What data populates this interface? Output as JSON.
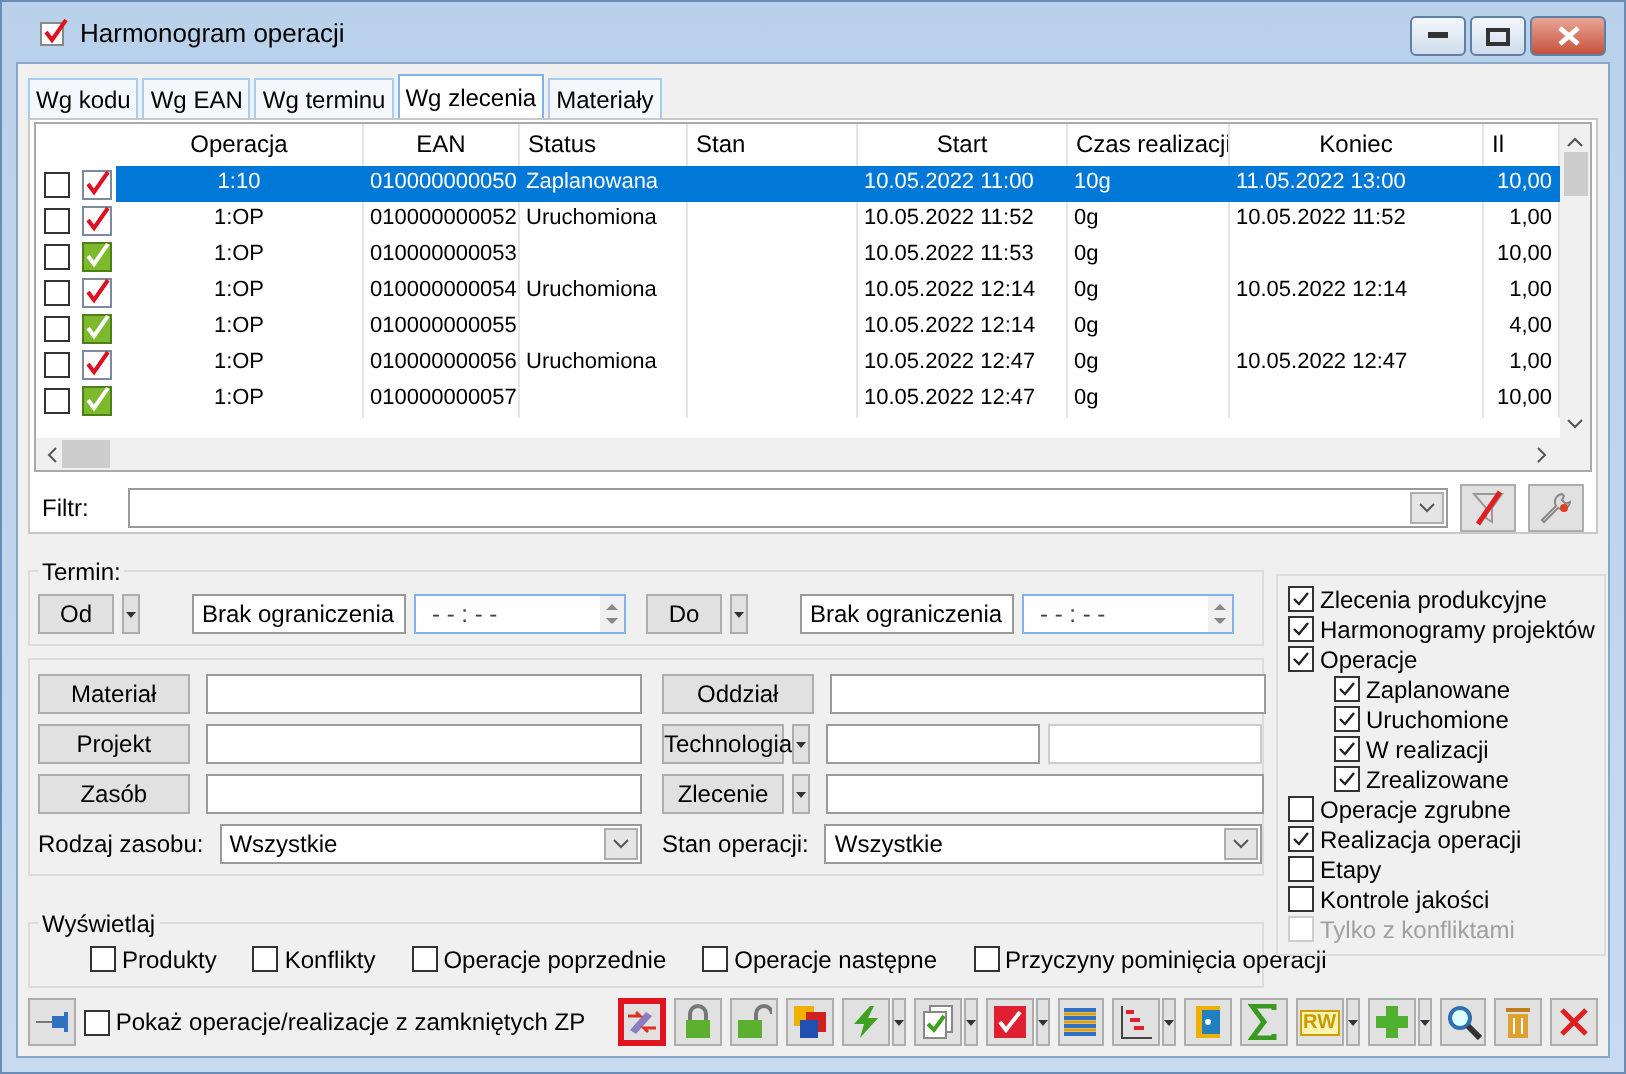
{
  "window": {
    "title": "Harmonogram operacji"
  },
  "tabs": [
    {
      "label": "Wg kodu",
      "selected": false
    },
    {
      "label": "Wg EAN",
      "selected": false
    },
    {
      "label": "Wg terminu",
      "selected": false
    },
    {
      "label": "Wg zlecenia",
      "selected": true
    },
    {
      "label": "Materiały",
      "selected": false
    }
  ],
  "table": {
    "columns": [
      "Operacja",
      "EAN",
      "Status",
      "Stan",
      "Start",
      "Czas realizacji",
      "Koniec",
      "Il"
    ],
    "rows": [
      {
        "checked": false,
        "kind": "red",
        "selected": true,
        "cells": [
          "1:10",
          "010000000050",
          "Zaplanowana",
          "",
          "10.05.2022 11:00",
          "10g",
          "11.05.2022 13:00",
          "10,00"
        ]
      },
      {
        "checked": false,
        "kind": "red",
        "selected": false,
        "cells": [
          "1:OP",
          "010000000052",
          "Uruchomiona",
          "",
          "10.05.2022 11:52",
          "0g",
          "10.05.2022 11:52",
          "1,00"
        ]
      },
      {
        "checked": false,
        "kind": "green",
        "selected": false,
        "cells": [
          "1:OP",
          "010000000053",
          "",
          "",
          "10.05.2022 11:53",
          "0g",
          "",
          "10,00"
        ]
      },
      {
        "checked": false,
        "kind": "red",
        "selected": false,
        "cells": [
          "1:OP",
          "010000000054",
          "Uruchomiona",
          "",
          "10.05.2022 12:14",
          "0g",
          "10.05.2022 12:14",
          "1,00"
        ]
      },
      {
        "checked": false,
        "kind": "green",
        "selected": false,
        "cells": [
          "1:OP",
          "010000000055",
          "",
          "",
          "10.05.2022 12:14",
          "0g",
          "",
          "4,00"
        ]
      },
      {
        "checked": false,
        "kind": "red",
        "selected": false,
        "cells": [
          "1:OP",
          "010000000056",
          "Uruchomiona",
          "",
          "10.05.2022 12:47",
          "0g",
          "10.05.2022 12:47",
          "1,00"
        ]
      },
      {
        "checked": false,
        "kind": "green",
        "selected": false,
        "cells": [
          "1:OP",
          "010000000057",
          "",
          "",
          "10.05.2022 12:47",
          "0g",
          "",
          "10,00"
        ]
      }
    ]
  },
  "filter": {
    "label": "Filtr:"
  },
  "term": {
    "label": "Termin:",
    "ranges": [
      {
        "button": "Od",
        "value": "Brak ograniczenia",
        "time": "- - : - -"
      },
      {
        "button": "Do",
        "value": "Brak ograniczenia",
        "time": "- - : - -"
      }
    ]
  },
  "filters": [
    {
      "kind": "button",
      "label": "Materiał"
    },
    {
      "kind": "button",
      "label": "Oddział"
    },
    {
      "kind": "button",
      "label": "Projekt"
    },
    {
      "kind": "menu-pair",
      "label": "Technologia"
    },
    {
      "kind": "button",
      "label": "Zasób"
    },
    {
      "kind": "menu",
      "label": "Zlecenie"
    },
    {
      "kind": "select",
      "label": "Rodzaj zasobu:",
      "value": "Wszystkie"
    },
    {
      "kind": "select",
      "label": "Stan operacji:",
      "value": "Wszystkie"
    }
  ],
  "options": [
    {
      "label": "Zlecenia produkcyjne",
      "checked": true,
      "disabled": false
    },
    {
      "label": "Harmonogramy projektów",
      "checked": true,
      "disabled": false
    },
    {
      "label": "Operacje",
      "checked": true,
      "disabled": false,
      "children": [
        {
          "label": "Zaplanowane",
          "checked": true,
          "disabled": false
        },
        {
          "label": "Uruchomione",
          "checked": true,
          "disabled": false
        },
        {
          "label": "W realizacji",
          "checked": true,
          "disabled": false
        },
        {
          "label": "Zrealizowane",
          "checked": true,
          "disabled": false
        }
      ]
    },
    {
      "label": "Operacje zgrubne",
      "checked": false,
      "disabled": false
    },
    {
      "label": "Realizacja operacji",
      "checked": true,
      "disabled": false
    },
    {
      "label": "Etapy",
      "checked": false,
      "disabled": false
    },
    {
      "label": "Kontrole jakości",
      "checked": false,
      "disabled": false
    },
    {
      "label": "Tylko z konfliktami",
      "checked": false,
      "disabled": true
    }
  ],
  "display": {
    "label": "Wyświetlaj",
    "options": [
      {
        "label": "Produkty",
        "checked": false
      },
      {
        "label": "Konflikty",
        "checked": false
      },
      {
        "label": "Operacje poprzednie",
        "checked": false
      },
      {
        "label": "Operacje następne",
        "checked": false
      },
      {
        "label": "Przyczyny pominięcia operacji",
        "checked": false
      }
    ]
  },
  "toolbar": {
    "checkbox": {
      "label": "Pokaż operacje/realizacje z zamkniętych ZP",
      "checked": false
    },
    "tools": [
      {
        "kind": "swap",
        "dropdown": false,
        "highlighted": true
      },
      {
        "kind": "lock",
        "dropdown": false,
        "highlighted": false
      },
      {
        "kind": "unlock",
        "dropdown": false,
        "highlighted": false
      },
      {
        "kind": "squares",
        "dropdown": false,
        "highlighted": false
      },
      {
        "kind": "lightning",
        "dropdown": true,
        "highlighted": false
      },
      {
        "kind": "documents",
        "dropdown": true,
        "highlighted": false
      },
      {
        "kind": "check",
        "dropdown": true,
        "highlighted": false
      },
      {
        "kind": "bars",
        "dropdown": false,
        "highlighted": false
      },
      {
        "kind": "chart",
        "dropdown": true,
        "highlighted": false
      },
      {
        "kind": "door",
        "dropdown": false,
        "highlighted": false
      },
      {
        "kind": "sum",
        "dropdown": false,
        "highlighted": false
      },
      {
        "kind": "text",
        "text": "RW",
        "dropdown": true,
        "highlighted": false
      },
      {
        "kind": "plus",
        "dropdown": true,
        "highlighted": false
      },
      {
        "kind": "search",
        "dropdown": false,
        "highlighted": false
      },
      {
        "kind": "trash",
        "dropdown": false,
        "highlighted": false
      },
      {
        "kind": "close",
        "dropdown": false,
        "highlighted": false
      }
    ]
  }
}
